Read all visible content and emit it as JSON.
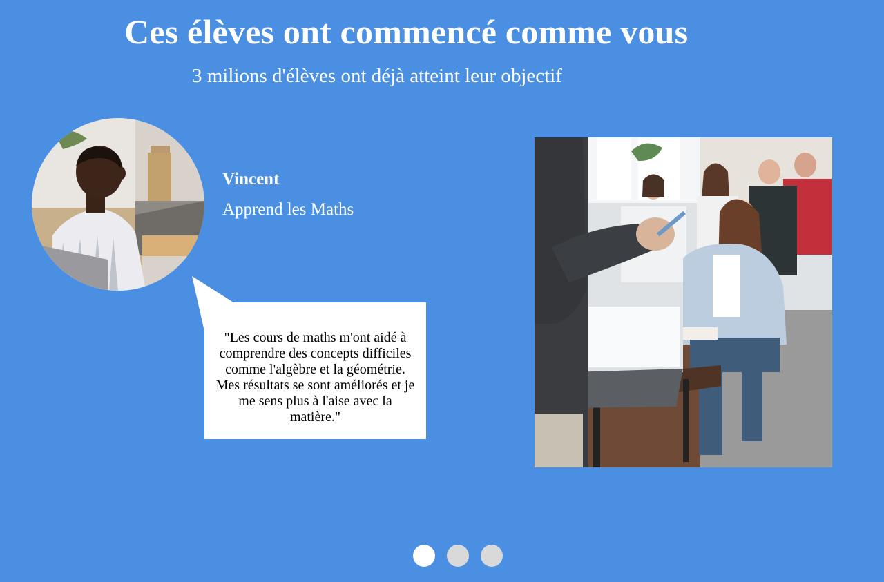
{
  "section": {
    "title": "Ces élèves ont commencé comme vous",
    "subtitle": "3 milions d'élèves ont déjà atteint leur objectif"
  },
  "testimonial": {
    "name": "Vincent",
    "subject": "Apprend les Maths",
    "quote": "\"Les cours de maths m'ont aidé à comprendre des concepts difficiles comme l'algèbre et la géométrie. Mes résultats se sont améliorés et je me sens plus à l'aise avec la matière.\""
  },
  "carousel": {
    "slide_count": 3,
    "active_index": 0
  },
  "colors": {
    "background": "#4a8fe2",
    "text": "#ffffff",
    "bubble": "#ffffff",
    "dot_active": "#ffffff",
    "dot_inactive": "#d9d9d9"
  }
}
